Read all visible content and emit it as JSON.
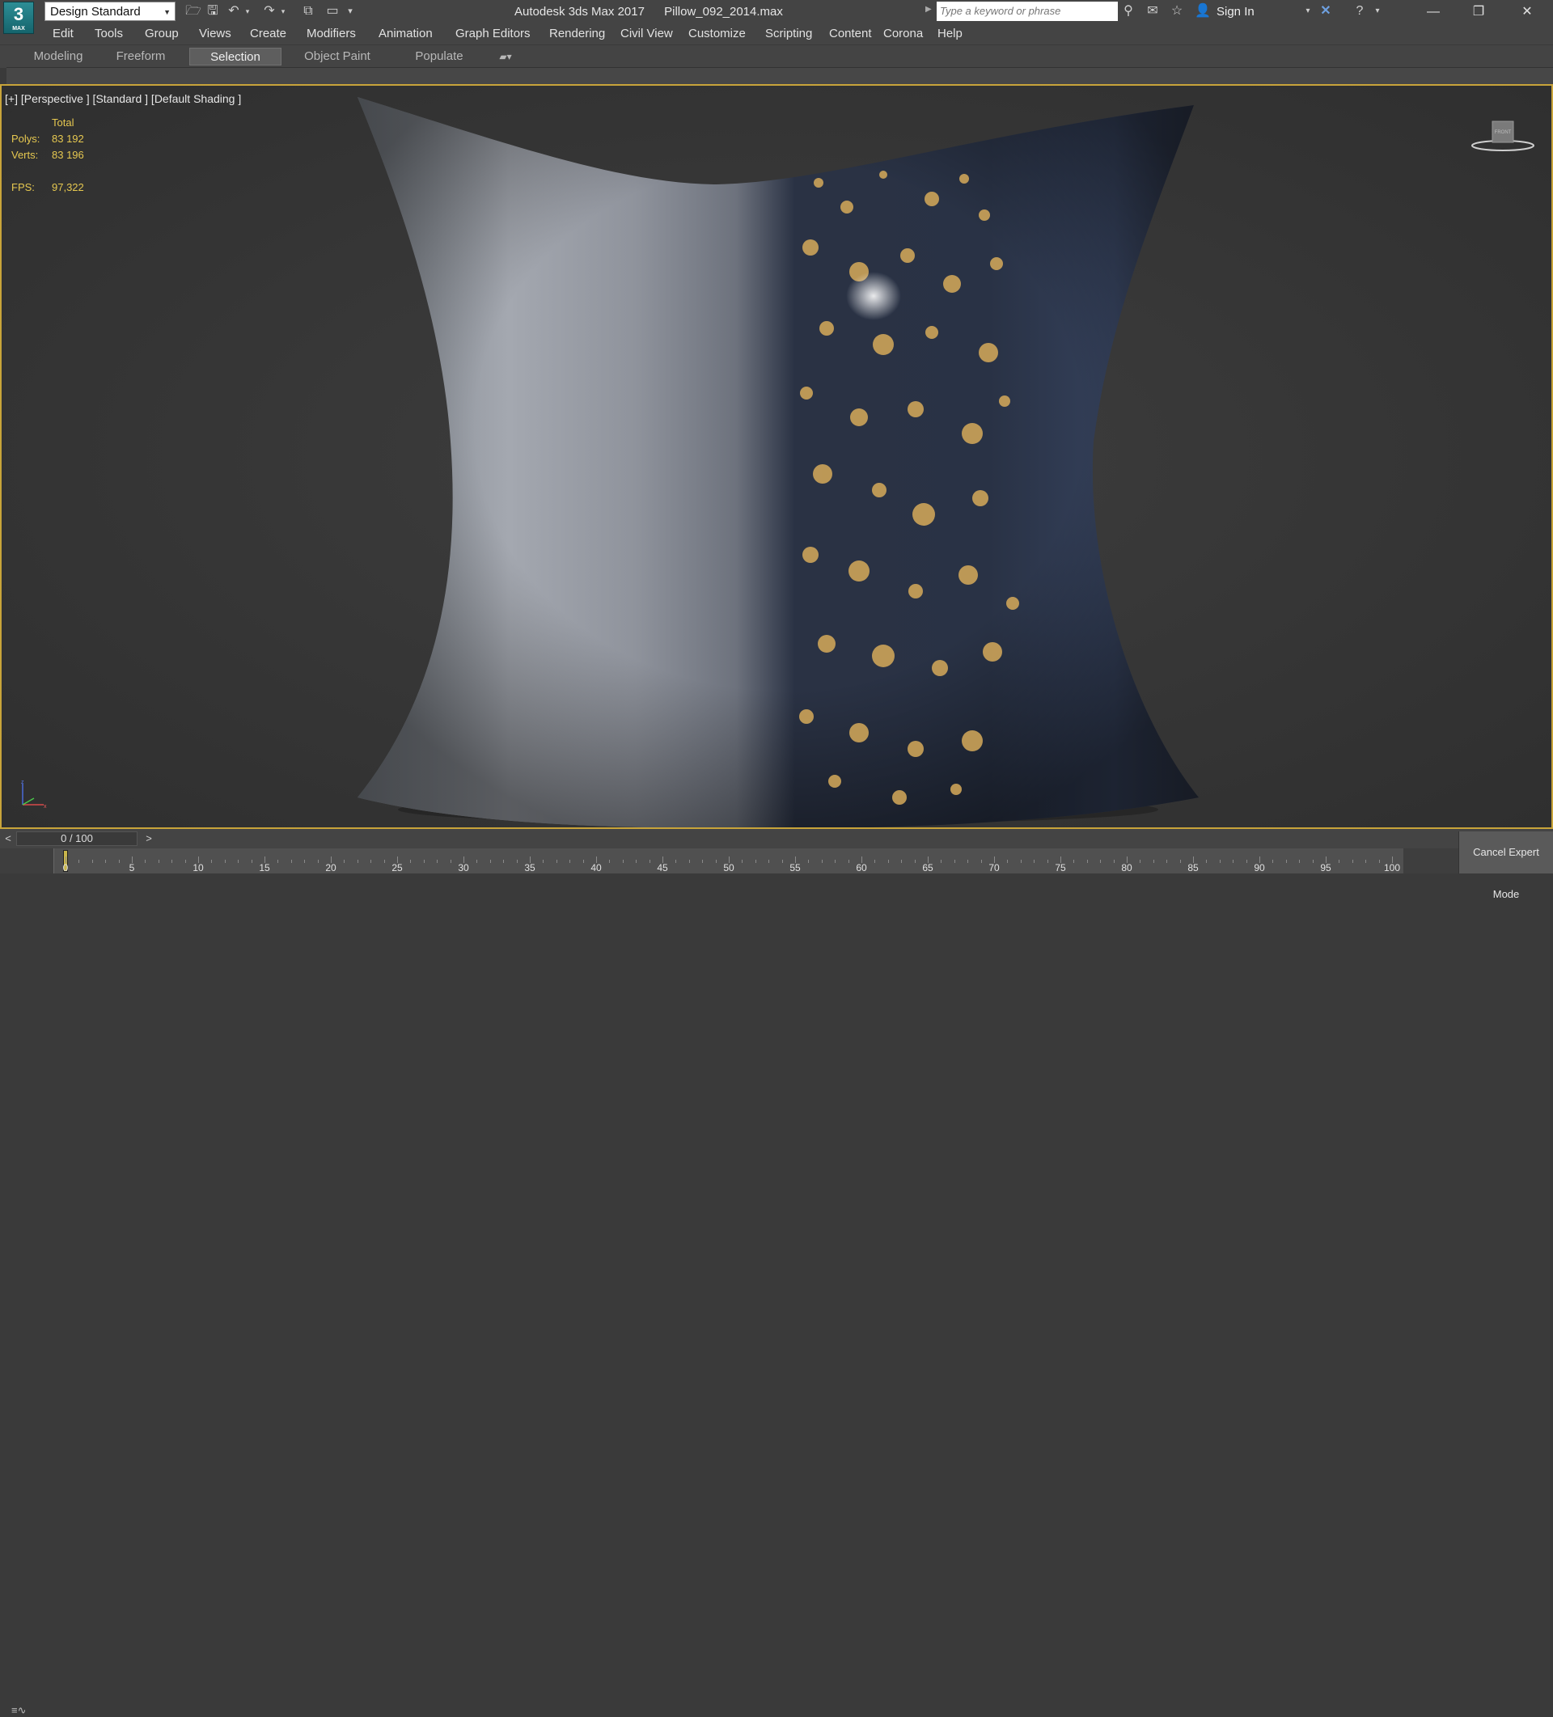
{
  "titlebar": {
    "app_logo_number": "3",
    "app_logo_text": "MAX",
    "workspace": "Design Standard",
    "app_name": "Autodesk 3ds Max 2017",
    "file_name": "Pillow_092_2014.max",
    "search_placeholder": "Type a keyword or phrase",
    "sign_in": "Sign In",
    "icons": [
      "open-file-icon",
      "save-icon",
      "undo-icon",
      "redo-icon",
      "project-icon",
      "workspace-icon",
      "binoculars-icon",
      "x-exchange-icon",
      "star-icon",
      "user-icon",
      "help-icon"
    ]
  },
  "menu": [
    "Edit",
    "Tools",
    "Group",
    "Views",
    "Create",
    "Modifiers",
    "Animation",
    "Graph Editors",
    "Rendering",
    "Civil View",
    "Customize",
    "Scripting",
    "Content",
    "Corona",
    "Help"
  ],
  "ribbon": {
    "tabs": [
      "Modeling",
      "Freeform",
      "Selection",
      "Object Paint",
      "Populate"
    ],
    "active_tab": "Selection"
  },
  "viewport": {
    "label": "[+] [Perspective ] [Standard ] [Default Shading ]",
    "stats_header": "Total",
    "polys_label": "Polys:",
    "polys_value": "83 192",
    "verts_label": "Verts:",
    "verts_value": "83 196",
    "fps_label": "FPS:",
    "fps_value": "97,322",
    "viewcube_face": "FRONT",
    "active_border_color": "#c8a43a"
  },
  "timeline": {
    "prev": "<",
    "next": ">",
    "frame_display": "0 / 100",
    "current_frame": 0,
    "total_frames": 100,
    "tick_labels": [
      "0",
      "5",
      "10",
      "15",
      "20",
      "25",
      "30",
      "35",
      "40",
      "45",
      "50",
      "55",
      "60",
      "65",
      "70",
      "75",
      "80",
      "85",
      "90",
      "95",
      "100"
    ],
    "cancel_expert": "Cancel Expert Mode"
  }
}
